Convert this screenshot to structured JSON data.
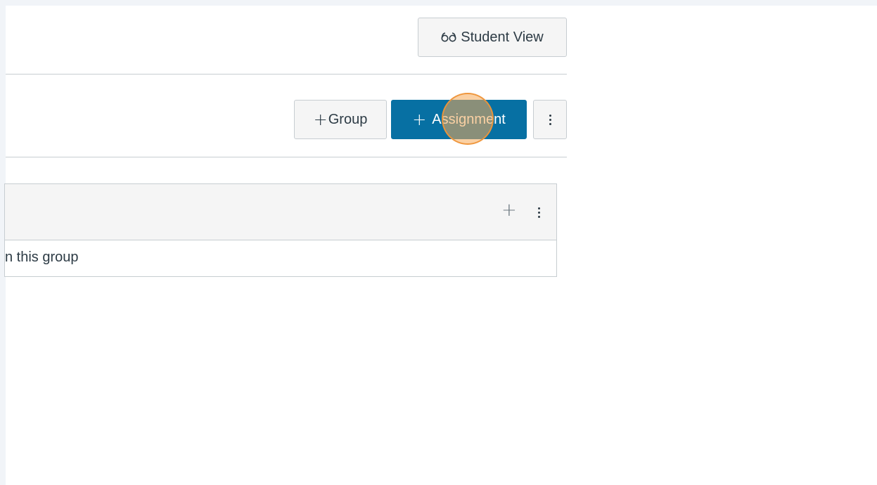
{
  "header": {
    "student_view_label": "Student View",
    "student_view_icon": "glasses-icon"
  },
  "toolbar": {
    "add_group_plus": "+",
    "add_group_label": "Group",
    "add_assignment_plus": "+",
    "add_assignment_label": "Assignment",
    "more_options_icon": "kebab-menu-icon",
    "primary_color": "#0770a3"
  },
  "assignment_group": {
    "add_icon": "plus-icon",
    "add_glyph": "+",
    "options_icon": "kebab-menu-icon",
    "empty_message": "n this group"
  },
  "click_marker_color": "#f6aa58"
}
